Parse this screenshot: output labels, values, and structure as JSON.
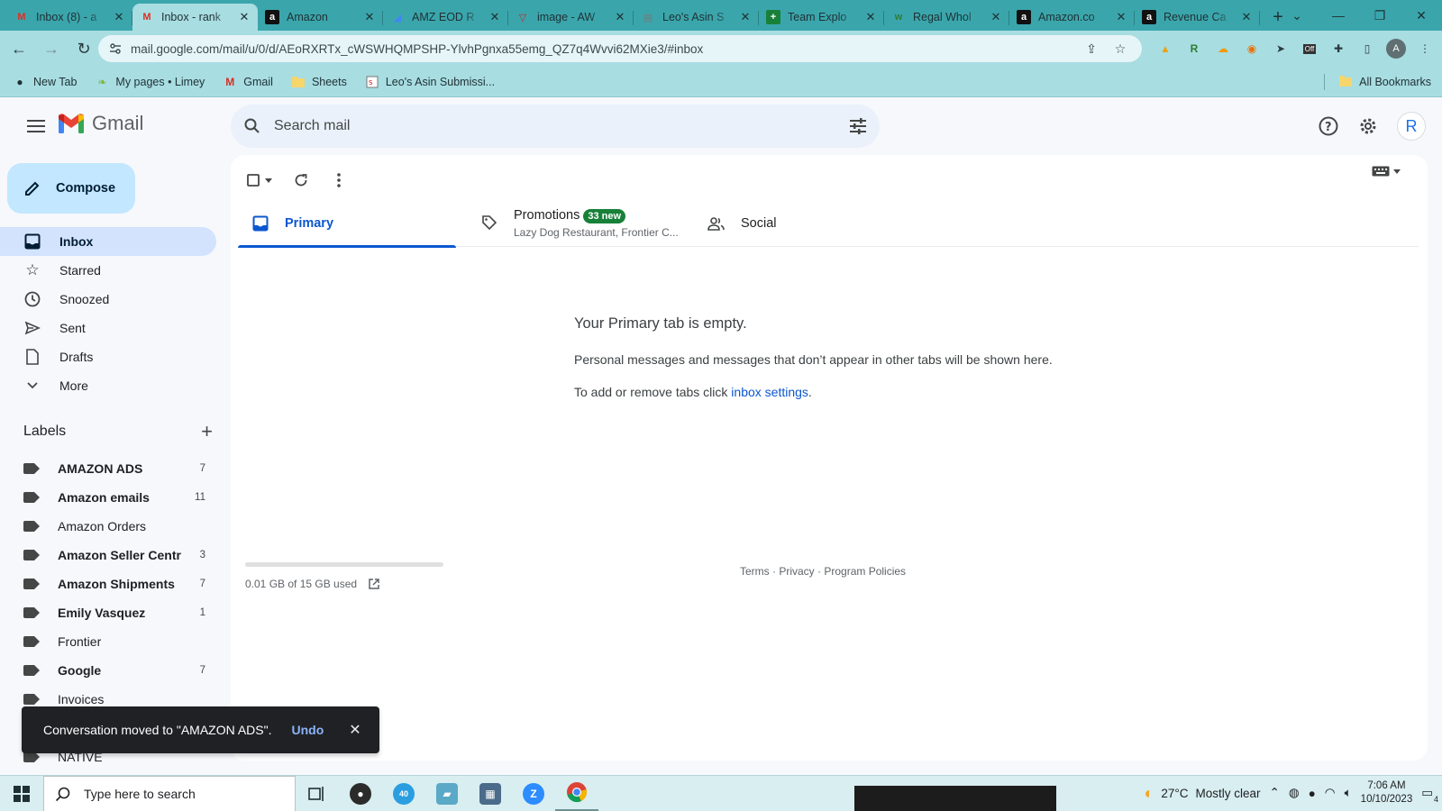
{
  "browser": {
    "tabs": [
      {
        "title": "Inbox (8) - a",
        "favicon": "gmail-icon",
        "active": false
      },
      {
        "title": "Inbox - rank",
        "favicon": "gmail-icon",
        "active": true
      },
      {
        "title": "Amazon",
        "favicon": "amazon-icon",
        "active": false
      },
      {
        "title": "AMZ EOD R",
        "favicon": "chart-icon",
        "active": false
      },
      {
        "title": "image - AW",
        "favicon": "v-icon",
        "active": false
      },
      {
        "title": "Leo's Asin S",
        "favicon": "doc-icon",
        "active": false
      },
      {
        "title": "Team Explo",
        "favicon": "sheets-plus-icon",
        "active": false
      },
      {
        "title": "Regal Whol",
        "favicon": "w-icon",
        "active": false
      },
      {
        "title": "Amazon.co",
        "favicon": "amazon-icon",
        "active": false
      },
      {
        "title": "Revenue Ca",
        "favicon": "amazon-icon",
        "active": false
      }
    ],
    "url": "mail.google.com/mail/u/0/d/AEoRXRTx_cWSWHQMPSHP-YlvhPgnxa55emg_QZ7q4Wvvi62MXie3/#inbox",
    "profile_initial": "A",
    "bookmarks": [
      {
        "label": "New Tab",
        "icon": "globe-icon"
      },
      {
        "label": "My pages • Limey",
        "icon": "lime-icon"
      },
      {
        "label": "Gmail",
        "icon": "gmail-icon"
      },
      {
        "label": "Sheets",
        "icon": "folder-icon"
      },
      {
        "label": "Leo's Asin Submissi...",
        "icon": "doc-icon"
      }
    ],
    "all_bookmarks": "All Bookmarks"
  },
  "gmail": {
    "brand": "Gmail",
    "search_placeholder": "Search mail",
    "profile_initial": "R",
    "compose_label": "Compose",
    "nav": [
      {
        "label": "Inbox",
        "icon": "inbox-icon",
        "active": true
      },
      {
        "label": "Starred",
        "icon": "star-icon",
        "active": false
      },
      {
        "label": "Snoozed",
        "icon": "clock-icon",
        "active": false
      },
      {
        "label": "Sent",
        "icon": "send-icon",
        "active": false
      },
      {
        "label": "Drafts",
        "icon": "draft-icon",
        "active": false
      },
      {
        "label": "More",
        "icon": "chevron-down-icon",
        "active": false
      }
    ],
    "labels_title": "Labels",
    "labels": [
      {
        "name": "AMAZON ADS",
        "count": "7",
        "bold": true
      },
      {
        "name": "Amazon emails",
        "count": "11",
        "bold": true
      },
      {
        "name": "Amazon Orders",
        "count": "",
        "bold": false
      },
      {
        "name": "Amazon Seller Centr",
        "count": "3",
        "bold": true
      },
      {
        "name": "Amazon Shipments",
        "count": "7",
        "bold": true
      },
      {
        "name": "Emily Vasquez",
        "count": "1",
        "bold": true
      },
      {
        "name": "Frontier",
        "count": "",
        "bold": false
      },
      {
        "name": "Google",
        "count": "7",
        "bold": true
      },
      {
        "name": "Invoices",
        "count": "",
        "bold": false
      },
      {
        "name": "",
        "count": "",
        "bold": false
      },
      {
        "name": "NATIVE",
        "count": "",
        "bold": false
      }
    ],
    "tabs": {
      "primary": "Primary",
      "promotions": "Promotions",
      "promotions_badge": "33 new",
      "promotions_sub": "Lazy Dog Restaurant, Frontier C...",
      "social": "Social"
    },
    "empty": {
      "title": "Your Primary tab is empty.",
      "line1": "Personal messages and messages that don’t appear in other tabs will be shown here.",
      "line2_prefix": "To add or remove tabs click ",
      "line2_link": "inbox settings",
      "line2_suffix": "."
    },
    "storage_text": "0.01 GB of 15 GB used",
    "storage_fraction": 0.0007,
    "footer": {
      "terms": "Terms",
      "privacy": "Privacy",
      "policies": "Program Policies",
      "sep": " · "
    },
    "snackbar": {
      "message": "Conversation moved to \"AMAZON ADS\".",
      "undo": "Undo"
    }
  },
  "taskbar": {
    "search_placeholder": "Type here to search",
    "temperature": "27°C",
    "weather": "Mostly clear",
    "time": "7:06 AM",
    "date": "10/10/2023",
    "notifications": "4",
    "taskbar_badge": "40"
  }
}
